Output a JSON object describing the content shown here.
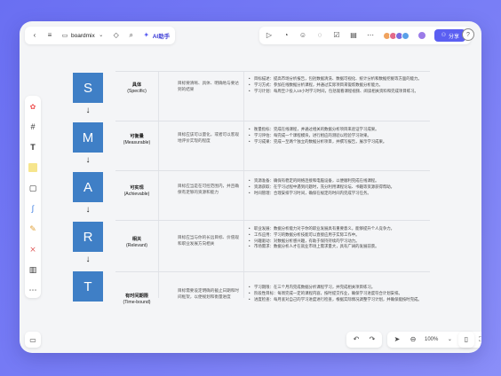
{
  "topbar": {
    "brand": "boardmix",
    "ai_label": "AI助手",
    "share_label": "分享",
    "help": "?"
  },
  "smart": {
    "letters": [
      "S",
      "M",
      "A",
      "R",
      "T"
    ],
    "arrow": "↓"
  },
  "rows": [
    {
      "name": "具体",
      "en": "(Specific)",
      "desc": "目标要清晰、具体、明确地与要达到的结果",
      "bullets": [
        "目标描述：提高市场分析报告，包括数据清洗、数据可视化、统计分析和数据挖掘等方面的能力。",
        "学习方式：参加在线数据分析课程，并通过实际项目来锻炼数据分析能力。",
        "学习计划：每周至少投入10小时学习时间，包括观看课程视频、阅读相关资料和完成项目练习。"
      ]
    },
    {
      "name": "可衡量",
      "en": "(Measurable)",
      "desc": "目标应该可以量化，或者可以客观地评价实现的程度",
      "bullets": [
        "衡量指标：完成在线课程，并通过相关的数据分析项目来验证学习成果。",
        "学习评估：每完成一个课程模块，进行相应的测验以检验学习效果。",
        "学习成果：完成一至两个独立的数据分析项目，并撰写报告，展示学习成果。"
      ]
    },
    {
      "name": "可实现",
      "en": "(Achievable)",
      "desc": "目标应当是在可控范围内，并且确保有足够的资源和能力",
      "bullets": [
        "资源准备：确保有稳定的网络连接和电脑设备，以便顺利完成在线课程。",
        "资源获取：在学习过程中遇到问题时，充分利用课程论坛、书籍等资源获得帮助。",
        "时间管理：合理安排学习时间，确保在规定的时间内完成学习任务。"
      ]
    },
    {
      "name": "相关",
      "en": "(Relevant)",
      "desc": "目标应当与你的长远目标、价值观和职业发展方向相关",
      "bullets": [
        "职业发展：数据分析能力对于你的职业发展具有重要意义，能够提升个人竞争力。",
        "工作应用：学习的数据分析技能可以直接应用于实际工作中。",
        "兴趣驱动：对数据分析感兴趣，有助于保持持续的学习动力。",
        "市场需求：数据分析人才在就业市场上需求量大，具有广阔的发展前景。"
      ]
    },
    {
      "name": "有时间期限",
      "en": "(Time-bound)",
      "desc": "目标需要设定明确的截止日期和时间框架，以便规划和衡量进度",
      "bullets": [
        "学习期限：在三个月内完成数据分析课程学习，并完成相关项目练习。",
        "阶段性目标：每周完成一定的课程内容，按时提交作业，确保学习进度符合计划安排。",
        "进度检查：每月底对自己的学习进度进行检查，根据实际情况调整学习计划，并确保能按时完成。"
      ]
    }
  ],
  "zoom": "100%"
}
